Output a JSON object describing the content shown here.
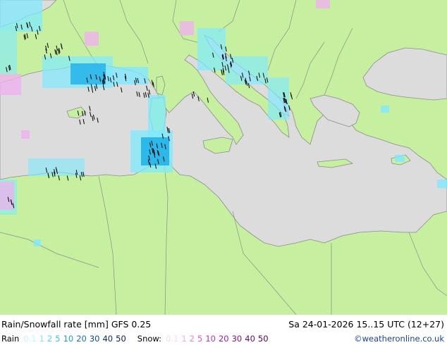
{
  "header": {
    "title": "Rain/Snowfall rate [mm] GFS 0.25",
    "datetime": "Sa 24-01-2026 15..15 UTC (12+27)"
  },
  "legend": {
    "rain_label": "Rain",
    "rain_values": [
      {
        "text": "0.1",
        "color": "#bff6ff"
      },
      {
        "text": "1",
        "color": "#7fe9ff"
      },
      {
        "text": "2",
        "color": "#4fd8f5"
      },
      {
        "text": "5",
        "color": "#2fc6e8"
      },
      {
        "text": "10",
        "color": "#1a9ee0"
      },
      {
        "text": "20",
        "color": "#1570c8"
      },
      {
        "text": "30",
        "color": "#0d45a8"
      },
      {
        "text": "40",
        "color": "#0a2a80"
      },
      {
        "text": "50",
        "color": "#061860"
      }
    ],
    "snow_label": "Snow:",
    "snow_values": [
      {
        "text": "0.1",
        "color": "#ffd8ff"
      },
      {
        "text": "1",
        "color": "#f5a8f5"
      },
      {
        "text": "2",
        "color": "#ee80ee"
      },
      {
        "text": "5",
        "color": "#e050e0"
      },
      {
        "text": "10",
        "color": "#c92cc9"
      },
      {
        "text": "20",
        "color": "#a51aa5"
      },
      {
        "text": "30",
        "color": "#861086"
      },
      {
        "text": "40",
        "color": "#6a0a6a"
      },
      {
        "text": "50",
        "color": "#500550"
      }
    ]
  },
  "credit": "©weatheronline.co.uk",
  "colors": {
    "land": "#c6f0a0",
    "sea": "#dcdcdc",
    "border": "#8c8c8c",
    "rain_light": "#7fe9ff",
    "rain_mid": "#1ab0e8",
    "rain_heavy": "#1560c0",
    "snow_light": "#f0b0f0"
  }
}
